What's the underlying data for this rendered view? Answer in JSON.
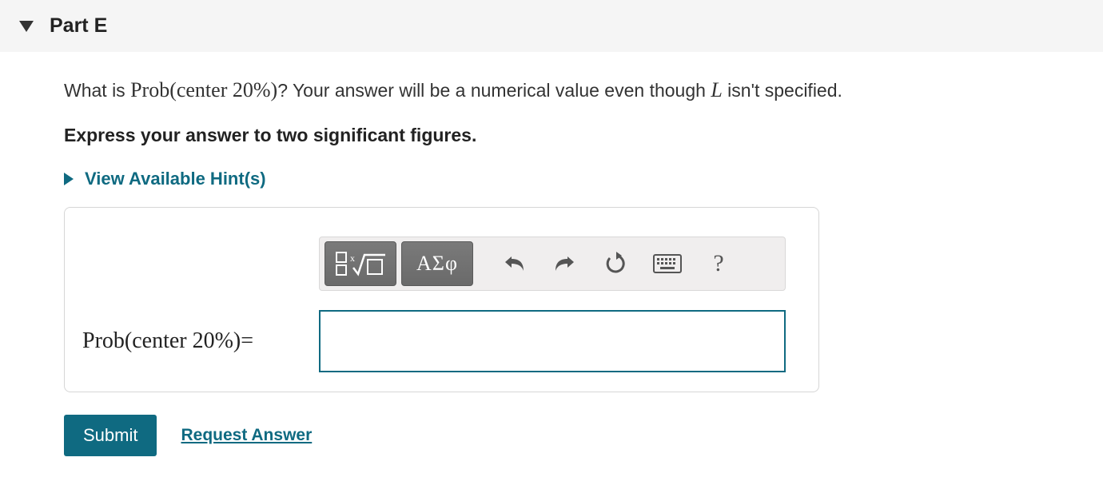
{
  "header": {
    "title": "Part E"
  },
  "prompt": {
    "lead": "What is ",
    "expr": "Prob(center 20%)",
    "mid": "? Your answer will be a numerical value even though ",
    "var": "L",
    "tail": " isn't specified."
  },
  "instruction": "Express your answer to two significant figures.",
  "hint": {
    "label": "View Available Hint(s)"
  },
  "answer": {
    "label": "Prob(center 20%) ",
    "equals": "=",
    "value": ""
  },
  "toolbar": {
    "templates_name": "templates-button",
    "symbols_label": "ΑΣφ",
    "undo_name": "undo",
    "redo_name": "redo",
    "reset_name": "reset",
    "keyboard_name": "keyboard",
    "help_label": "?"
  },
  "footer": {
    "submit": "Submit",
    "request": "Request Answer"
  }
}
